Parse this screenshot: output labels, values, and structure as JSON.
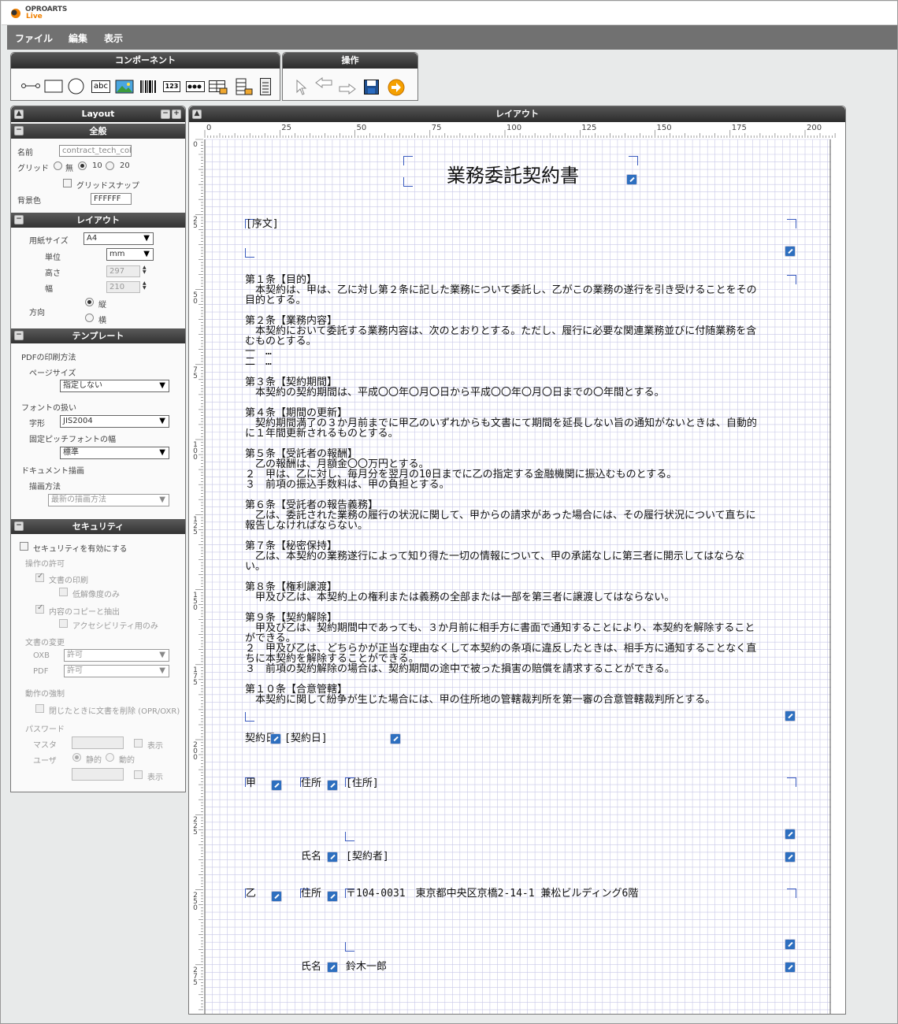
{
  "brand": {
    "name": "OPROARTS",
    "sub": "Live"
  },
  "menu": [
    "ファイル",
    "編集",
    "表示"
  ],
  "component_panel": {
    "title": "コンポーネント",
    "items": [
      "line-tool",
      "rectangle-tool",
      "ellipse-tool",
      "text-tool",
      "image-tool",
      "barcode-tool",
      "qrcode-tool",
      "number-tool",
      "table-tool",
      "list-tool",
      "page-tool"
    ],
    "text_icon_label": "abc",
    "num_icon_label": "123"
  },
  "operation_panel": {
    "title": "操作",
    "items": [
      "select-tool",
      "undo",
      "redo",
      "save",
      "run"
    ]
  },
  "left_panel": {
    "title": "Layout",
    "general": {
      "title": "全般",
      "name_label": "名前",
      "name_value": "contract_tech_colu",
      "grid_label": "グリッド",
      "grid_options": [
        "無",
        "10",
        "20"
      ],
      "grid_selected": "10",
      "snap_label": "グリッドスナップ",
      "bg_label": "背景色",
      "bg_value": "FFFFFF"
    },
    "layout": {
      "title": "レイアウト",
      "paper_label": "用紙サイズ",
      "paper_value": "A4",
      "unit_label": "単位",
      "unit_value": "mm",
      "height_label": "高さ",
      "height_value": "297",
      "width_label": "幅",
      "width_value": "210",
      "orientation_label": "方向",
      "orientation_options": [
        "縦",
        "横"
      ],
      "orientation_selected": "縦"
    },
    "template": {
      "title": "テンプレート",
      "pdf_print_label": "PDFの印刷方法",
      "page_size_label": "ページサイズ",
      "page_size_value": "指定しない",
      "font_handling_label": "フォントの扱い",
      "charset_label": "字形",
      "charset_value": "JIS2004",
      "fixed_pitch_label": "固定ピッチフォントの幅",
      "fixed_pitch_value": "標準",
      "doc_draw_label": "ドキュメント描画",
      "draw_method_label": "描画方法",
      "draw_method_value": "最新の描画方法"
    },
    "security": {
      "title": "セキュリティ",
      "enable_label": "セキュリティを有効にする",
      "permission_label": "操作の許可",
      "print_label": "文書の印刷",
      "low_res_label": "低解像度のみ",
      "copy_label": "内容のコピーと抽出",
      "access_label": "アクセシビリティ用のみ",
      "change_label": "文書の変更",
      "oxb_label": "OXB",
      "oxb_value": "許可",
      "pdf_label": "PDF",
      "pdf_value": "許可",
      "force_label": "動作の強制",
      "delete_label": "閉じたときに文書を削除 (OPR/OXR)",
      "password_label": "パスワード",
      "master_label": "マスタ",
      "show_label": "表示",
      "user_label": "ユーザ",
      "user_options": [
        "静的",
        "動的"
      ],
      "user_selected": "静的"
    }
  },
  "layout_panel": {
    "title": "レイアウト",
    "ruler_h": [
      "0",
      "25",
      "50",
      "75",
      "100",
      "125",
      "150",
      "175",
      "200"
    ],
    "ruler_v": [
      "0",
      "25",
      "50",
      "75",
      "100",
      "125",
      "150",
      "175",
      "200",
      "225",
      "250",
      "275"
    ]
  },
  "document": {
    "title": "業務委託契約書",
    "preamble": "[序文]",
    "articles": [
      [
        "第１条【目的】",
        "　本契約は、甲は、乙に対し第２条に記した業務について委託し、乙がこの業務の遂行を引き受けることをその",
        "目的とする。"
      ],
      [
        "第２条【業務内容】",
        "　本契約において委託する業務内容は、次のとおりとする。ただし、履行に必要な関連業務並びに付随業務を含",
        "むものとする。",
        "一　…",
        "二　…"
      ],
      [
        "第３条【契約期間】",
        "　本契約の契約期間は、平成〇〇年〇月〇日から平成〇〇年〇月〇日までの〇年間とする。"
      ],
      [
        "第４条【期間の更新】",
        "　契約期間満了の３か月前までに甲乙のいずれからも文書にて期間を延長しない旨の通知がないときは、自動的",
        "に１年間更新されるものとする。"
      ],
      [
        "第５条【受託者の報酬】",
        "　乙の報酬は、月額金〇〇万円とする。",
        "２　甲は、乙に対し、毎月分を翌月の10日までに乙の指定する金融機関に振込むものとする。",
        "３　前項の振込手数料は、甲の負担とする。"
      ],
      [
        "第６条【受託者の報告義務】",
        "　乙は、委託された業務の履行の状況に関して、甲からの請求があった場合には、その履行状況について直ちに",
        "報告しなければならない。"
      ],
      [
        "第７条【秘密保持】",
        "　乙は、本契約の業務遂行によって知り得た一切の情報について、甲の承諾なしに第三者に開示してはならな",
        "い。"
      ],
      [
        "第８条【権利譲渡】",
        "　甲及び乙は、本契約上の権利または義務の全部または一部を第三者に譲渡してはならない。"
      ],
      [
        "第９条【契約解除】",
        "　甲及び乙は、契約期間中であっても、３か月前に相手方に書面で通知することにより、本契約を解除すること",
        "ができる。",
        "２　甲及び乙は、どちらかが正当な理由なくして本契約の条項に違反したときは、相手方に通知することなく直",
        "ちに本契約を解除することができる。",
        "３　前項の契約解除の場合は、契約期間の途中で被った損害の賠償を請求することができる。"
      ],
      [
        "第１０条【合意管轄】",
        "　本契約に関して紛争が生じた場合には、甲の住所地の管轄裁判所を第一審の合意管轄裁判所とする。"
      ]
    ],
    "contract_date_label": "契約日",
    "contract_date_value": "[契約日]",
    "party_a_label": "甲",
    "address_label": "住所",
    "party_a_address": "[住所]",
    "name_label": "氏名",
    "party_a_name": "[契約者]",
    "party_b_label": "乙",
    "party_b_address": "〒104-0031　東京都中央区京橋2-14-1 兼松ビルディング6階",
    "party_b_name": "鈴木一郎"
  },
  "colors": {
    "accent": "#f08000",
    "panel_header": "#333333",
    "grid_line": "#c8c8e8",
    "bracket": "#3a5bbf"
  }
}
